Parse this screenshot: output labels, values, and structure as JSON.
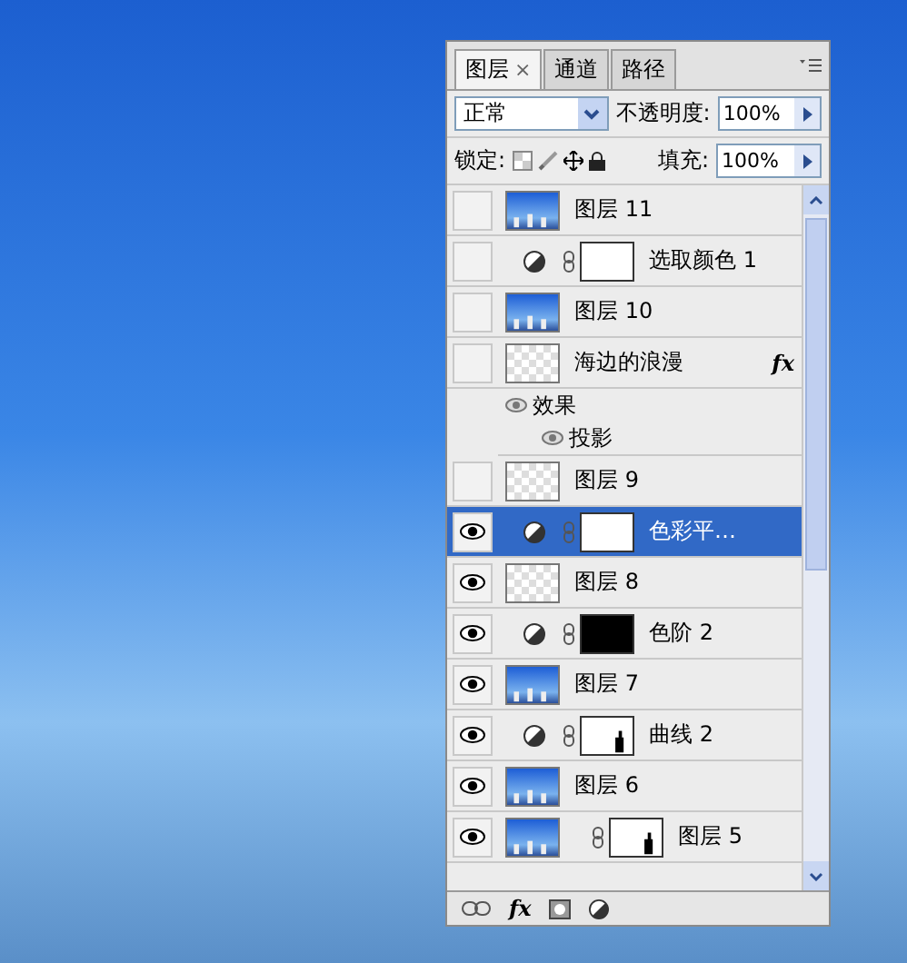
{
  "panel": {
    "tabs": [
      {
        "label": "图层",
        "selected": true,
        "close": "×"
      },
      {
        "label": "通道",
        "selected": false
      },
      {
        "label": "路径",
        "selected": false
      }
    ],
    "blend_mode": "正常",
    "opacity_label": "不透明度:",
    "opacity": "100%",
    "lock_label": "锁定:",
    "fill_label": "填充:",
    "fill": "100%",
    "layers": [
      {
        "kind": "layer",
        "name": "图层 11",
        "visible": false,
        "selected": false,
        "thumbnail": {
          "kind": "photo"
        }
      },
      {
        "kind": "adjustment",
        "name": "选取颜色 1",
        "visible": false,
        "selected": false,
        "mask": {
          "kind": "white"
        }
      },
      {
        "kind": "layer",
        "name": "图层 10",
        "visible": false,
        "selected": false,
        "thumbnail": {
          "kind": "photo"
        }
      },
      {
        "kind": "layer",
        "name": "海边的浪漫",
        "visible": false,
        "selected": false,
        "thumbnail": {
          "kind": "transparent"
        },
        "fx": "fx"
      },
      {
        "kind": "effects",
        "name": "效果"
      },
      {
        "kind": "effect",
        "name": "投影"
      },
      {
        "kind": "layer",
        "name": "图层 9",
        "visible": false,
        "selected": false,
        "thumbnail": {
          "kind": "transparent"
        }
      },
      {
        "kind": "adjustment",
        "name": "色彩平…",
        "visible": true,
        "selected": true,
        "mask": {
          "kind": "white"
        }
      },
      {
        "kind": "layer",
        "name": "图层 8",
        "visible": true,
        "selected": false,
        "thumbnail": {
          "kind": "transparent"
        }
      },
      {
        "kind": "adjustment",
        "name": "色阶 2",
        "visible": true,
        "selected": false,
        "mask": {
          "kind": "black"
        }
      },
      {
        "kind": "layer",
        "name": "图层 7",
        "visible": true,
        "selected": false,
        "thumbnail": {
          "kind": "photo"
        }
      },
      {
        "kind": "adjustment",
        "name": "曲线 2",
        "visible": true,
        "selected": false,
        "mask": {
          "kind": "silhouette"
        }
      },
      {
        "kind": "layer",
        "name": "图层 6",
        "visible": true,
        "selected": false,
        "thumbnail": {
          "kind": "photo"
        }
      },
      {
        "kind": "layer",
        "name": "图层 5",
        "visible": true,
        "selected": false,
        "thumbnail": {
          "kind": "photo"
        },
        "mask": {
          "kind": "silhouette"
        }
      }
    ],
    "footer_fx": "fx"
  }
}
